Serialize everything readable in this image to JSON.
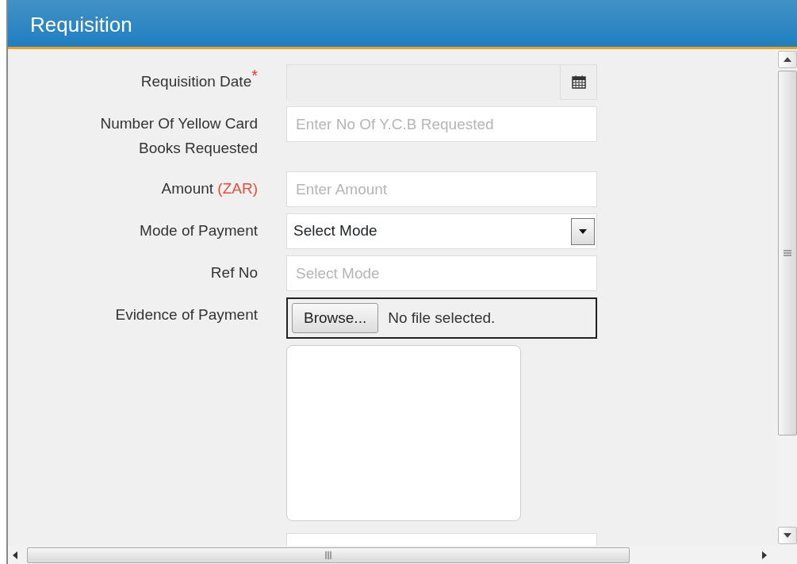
{
  "panel": {
    "title": "Requisition"
  },
  "fields": [
    {
      "kind": "date",
      "label": "Requisition Date",
      "required": true,
      "required_mark": "*",
      "disabled": true
    },
    {
      "kind": "text",
      "label": "Number Of Yellow Card Books Requested",
      "placeholder": "Enter No Of Y.C.B Requested"
    },
    {
      "kind": "text",
      "label": "Amount",
      "unit": "(ZAR)",
      "placeholder": "Enter Amount"
    },
    {
      "kind": "select",
      "label": "Mode of Payment",
      "value": "Select Mode"
    },
    {
      "kind": "text",
      "label": "Ref No",
      "placeholder": "Select Mode"
    },
    {
      "kind": "file",
      "label": "Evidence of Payment",
      "button": "Browse...",
      "status": "No file selected."
    },
    {
      "kind": "textarea"
    },
    {
      "kind": "cut"
    }
  ]
}
